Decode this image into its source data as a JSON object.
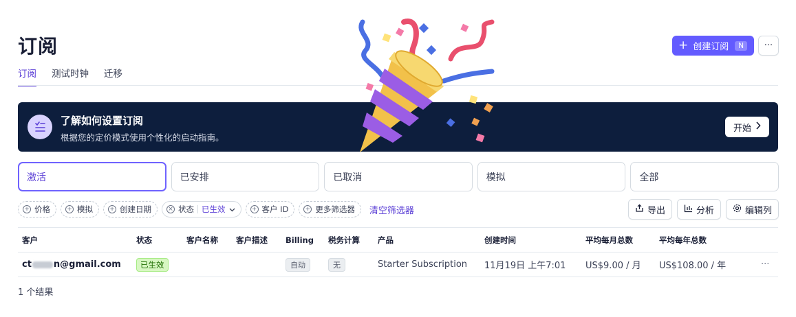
{
  "page": {
    "title": "订阅",
    "tabs": [
      "订阅",
      "测试时钟",
      "迁移"
    ],
    "create_button": {
      "label": "创建订阅",
      "shortcut": "N"
    },
    "more_button": "···"
  },
  "banner": {
    "title": "了解如何设置订阅",
    "subtitle": "根据您的定价模式使用个性化的启动指南。",
    "button_label": "开始",
    "colors": {
      "background": "#0d1e3d",
      "icon_bg": "#d9d3ff"
    }
  },
  "status_cards": [
    "激活",
    "已安排",
    "已取消",
    "模拟",
    "全部"
  ],
  "filters": {
    "chips": [
      "价格",
      "模拟",
      "创建日期"
    ],
    "status_chip": {
      "label": "状态",
      "value": "已生效"
    },
    "chips_after": [
      "客户 ID",
      "更多筛选器"
    ],
    "clear_label": "清空筛选器"
  },
  "actions": {
    "export": "导出",
    "analyze": "分析",
    "edit_columns": "编辑列"
  },
  "table": {
    "columns": [
      "客户",
      "状态",
      "客户名称",
      "客户描述",
      "Billing",
      "税务计算",
      "产品",
      "创建时间",
      "平均每月总数",
      "平均每年总数"
    ],
    "rows": [
      {
        "email_prefix": "ct",
        "email_suffix": "n@gmail.com",
        "status": "已生效",
        "customer_name": "",
        "customer_description": "",
        "billing": "自动",
        "tax": "无",
        "product": "Starter Subscription",
        "created": "11月19日 上午7:01",
        "monthly": "US$9.00 / 月",
        "yearly": "US$108.00 / 年",
        "more": "···"
      }
    ]
  },
  "results_text": "1 个结果",
  "colors": {
    "accent": "#635bff",
    "accent_text": "#5b3fd6",
    "success_bg": "#d7f7c2",
    "success_text": "#217005"
  },
  "overlay_icon": "party-popper-icon"
}
